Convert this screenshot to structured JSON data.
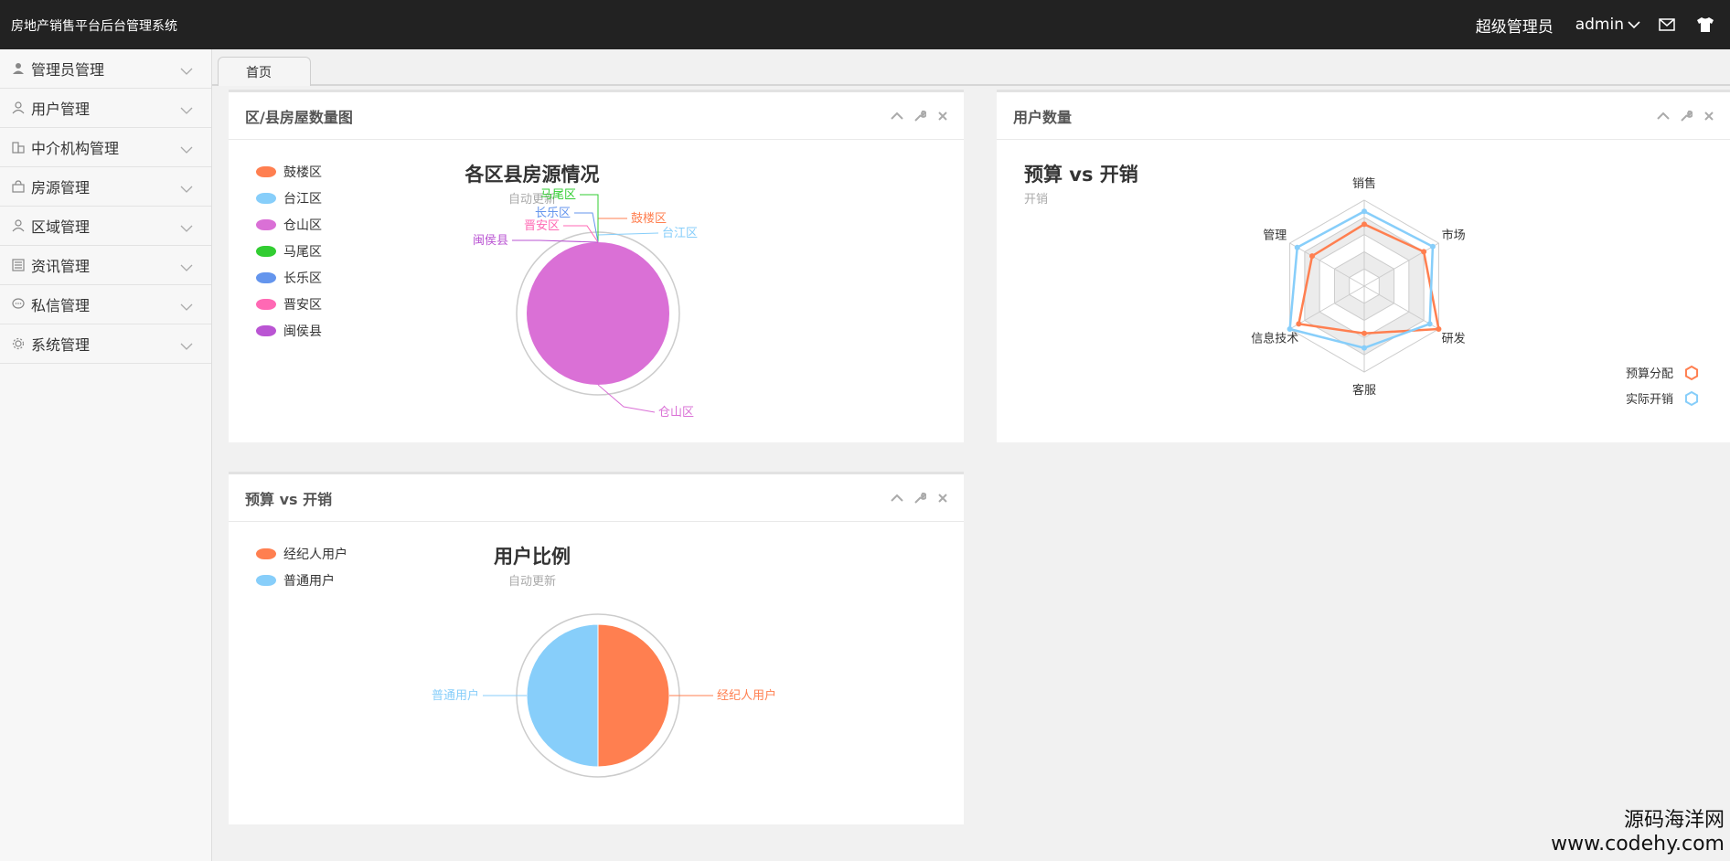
{
  "app": {
    "title": "房地产销售平台后台管理系统"
  },
  "header": {
    "role": "超级管理员",
    "username": "admin"
  },
  "sidebar": {
    "items": [
      {
        "label": "管理员管理",
        "icon": "person-icon"
      },
      {
        "label": "用户管理",
        "icon": "user-icon"
      },
      {
        "label": "中介机构管理",
        "icon": "building-icon"
      },
      {
        "label": "房源管理",
        "icon": "bag-icon"
      },
      {
        "label": "区域管理",
        "icon": "user-icon"
      },
      {
        "label": "资讯管理",
        "icon": "news-icon"
      },
      {
        "label": "私信管理",
        "icon": "chat-icon"
      },
      {
        "label": "系统管理",
        "icon": "gear-icon"
      }
    ]
  },
  "tabs": [
    {
      "label": "首页"
    }
  ],
  "panels": {
    "district": {
      "title": "区/县房屋数量图"
    },
    "users": {
      "title": "用户数量"
    },
    "budget": {
      "title": "预算 vs 开销"
    }
  },
  "watermark": {
    "line1": "源码海洋网",
    "line2": "www.codehy.com"
  },
  "colors": {
    "orange": "#ff7f50",
    "lightblue": "#87cefa",
    "orchid": "#da70d6",
    "green": "#32cd32",
    "blue": "#6495ed",
    "pink": "#ff69b4",
    "purple": "#ba55d3"
  },
  "chart_data": [
    {
      "type": "pie",
      "title": "各区县房源情况",
      "subtitle": "自动更新",
      "categories": [
        "鼓楼区",
        "台江区",
        "仓山区",
        "马尾区",
        "长乐区",
        "晋安区",
        "闽侯县"
      ],
      "colors": [
        "#ff7f50",
        "#87cefa",
        "#da70d6",
        "#32cd32",
        "#6495ed",
        "#ff69b4",
        "#ba55d3"
      ],
      "values": [
        0,
        0,
        1,
        0,
        0,
        0,
        0
      ],
      "legend": "top-left"
    },
    {
      "type": "radar",
      "title": "预算 vs 开销",
      "subtitle": "开销",
      "indicators": [
        "销售",
        "市场",
        "研发",
        "客服",
        "信息技术",
        "管理"
      ],
      "series": [
        {
          "name": "预算分配",
          "color": "#ff7f50",
          "values": [
            0.72,
            0.8,
            1.0,
            0.55,
            0.88,
            0.7
          ]
        },
        {
          "name": "实际开销",
          "color": "#87cefa",
          "values": [
            0.87,
            0.92,
            0.88,
            0.72,
            1.0,
            0.9
          ]
        }
      ],
      "legend": "bottom-right"
    },
    {
      "type": "pie",
      "title": "用户比例",
      "subtitle": "自动更新",
      "categories": [
        "经纪人用户",
        "普通用户"
      ],
      "colors": [
        "#ff7f50",
        "#87cefa"
      ],
      "values": [
        50,
        50
      ],
      "legend": "top-left"
    }
  ]
}
